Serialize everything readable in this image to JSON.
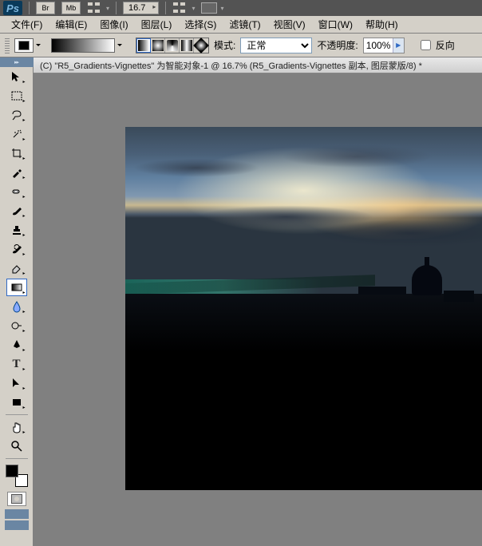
{
  "topbar": {
    "logo": "Ps",
    "br": "Br",
    "mb": "Mb",
    "zoom": "16.7"
  },
  "menu": {
    "file": "文件(F)",
    "edit": "编辑(E)",
    "image": "图像(I)",
    "layer": "图层(L)",
    "select": "选择(S)",
    "filter": "滤镜(T)",
    "view": "视图(V)",
    "window": "窗口(W)",
    "help": "帮助(H)"
  },
  "options": {
    "mode_label": "模式:",
    "mode_value": "正常",
    "opacity_label": "不透明度:",
    "opacity_value": "100%",
    "reverse_label": "反向"
  },
  "document": {
    "title": "(C) \"R5_Gradients-Vignettes\" 为智能对象-1 @ 16.7% (R5_Gradients-Vignettes 副本, 图层蒙版/8) *"
  },
  "tools": {
    "move": "↖",
    "marquee": "▭",
    "lasso": "◯",
    "wand": "✦",
    "crop": "✂",
    "eyedrop": "◐",
    "heal": "✚",
    "brush": "〜",
    "stamp": "⎌",
    "history": "↺",
    "eraser": "▱",
    "gradient": "▦",
    "blur": "◔",
    "dodge": "☼",
    "pen": "✎",
    "type": "T",
    "path": "↗",
    "shape": "■",
    "hand": "✋",
    "zoom": "🔍"
  }
}
